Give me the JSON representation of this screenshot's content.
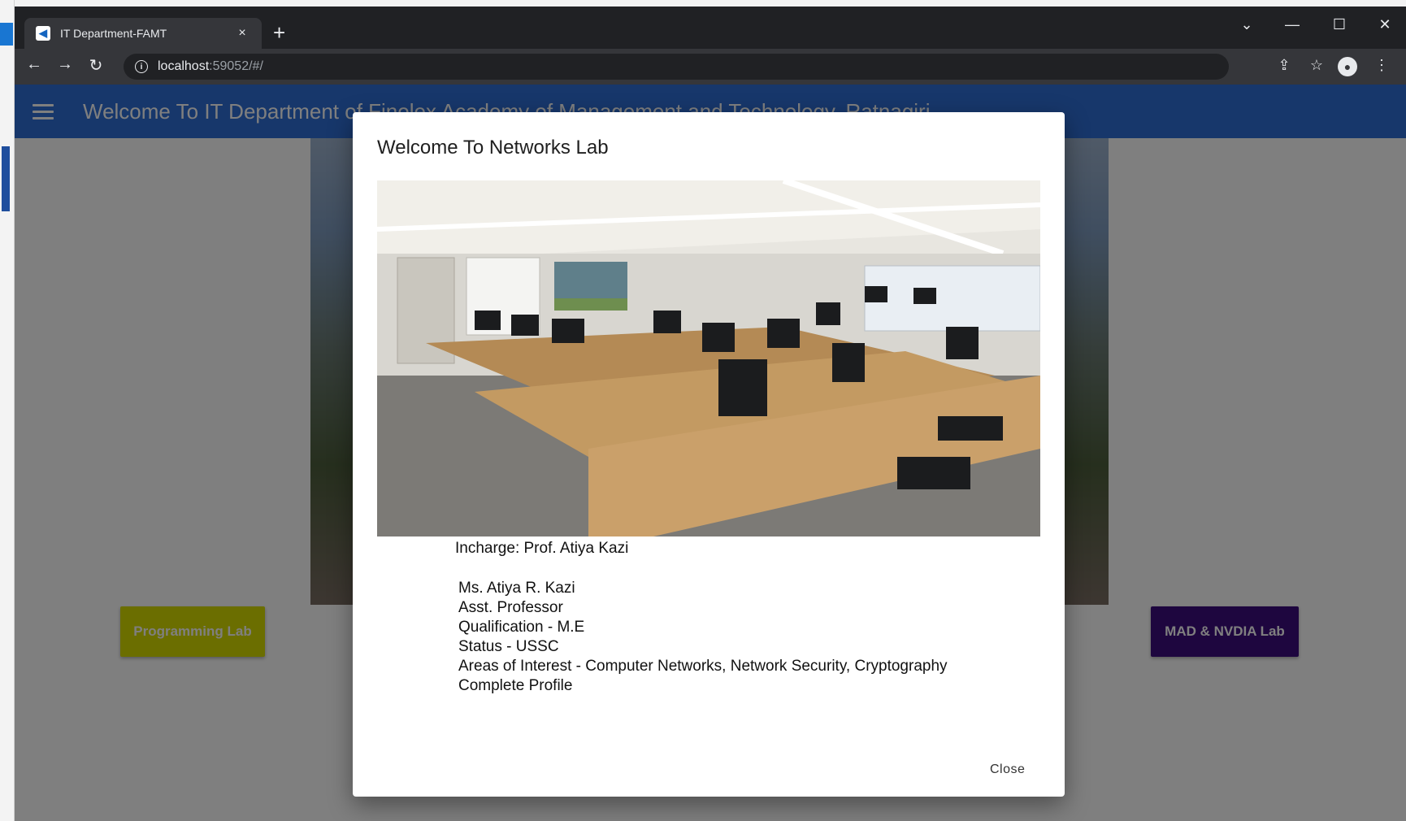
{
  "browser": {
    "tab_title": "IT Department-FAMT",
    "tab_favicon_icon": "flutter-icon",
    "close_tab_glyph": "×",
    "new_tab_glyph": "+",
    "url_host": "localhost",
    "url_rest": ":59052/#/",
    "window_controls": [
      "chevron-down-icon",
      "minimize-icon",
      "maximize-icon",
      "close-window-icon"
    ]
  },
  "app": {
    "title": "Welcome To IT Department of Finolex Academy of Management and Technology, Ratnagiri",
    "accent_color": "#2f6fd6",
    "buttons": {
      "programming_lab": "Programming Lab",
      "mad_nvdia_lab": "MAD & NVDIA Lab"
    }
  },
  "dialog": {
    "title": "Welcome To Networks Lab",
    "incharge": "Incharge: Prof. Atiya Kazi",
    "profile_lines": [
      "Ms. Atiya R. Kazi",
      "Asst. Professor",
      "Qualification - M.E",
      "Status - USSC",
      "Areas of Interest - Computer Networks, Network Security, Cryptography",
      "Complete Profile"
    ],
    "close_label": "Close"
  }
}
